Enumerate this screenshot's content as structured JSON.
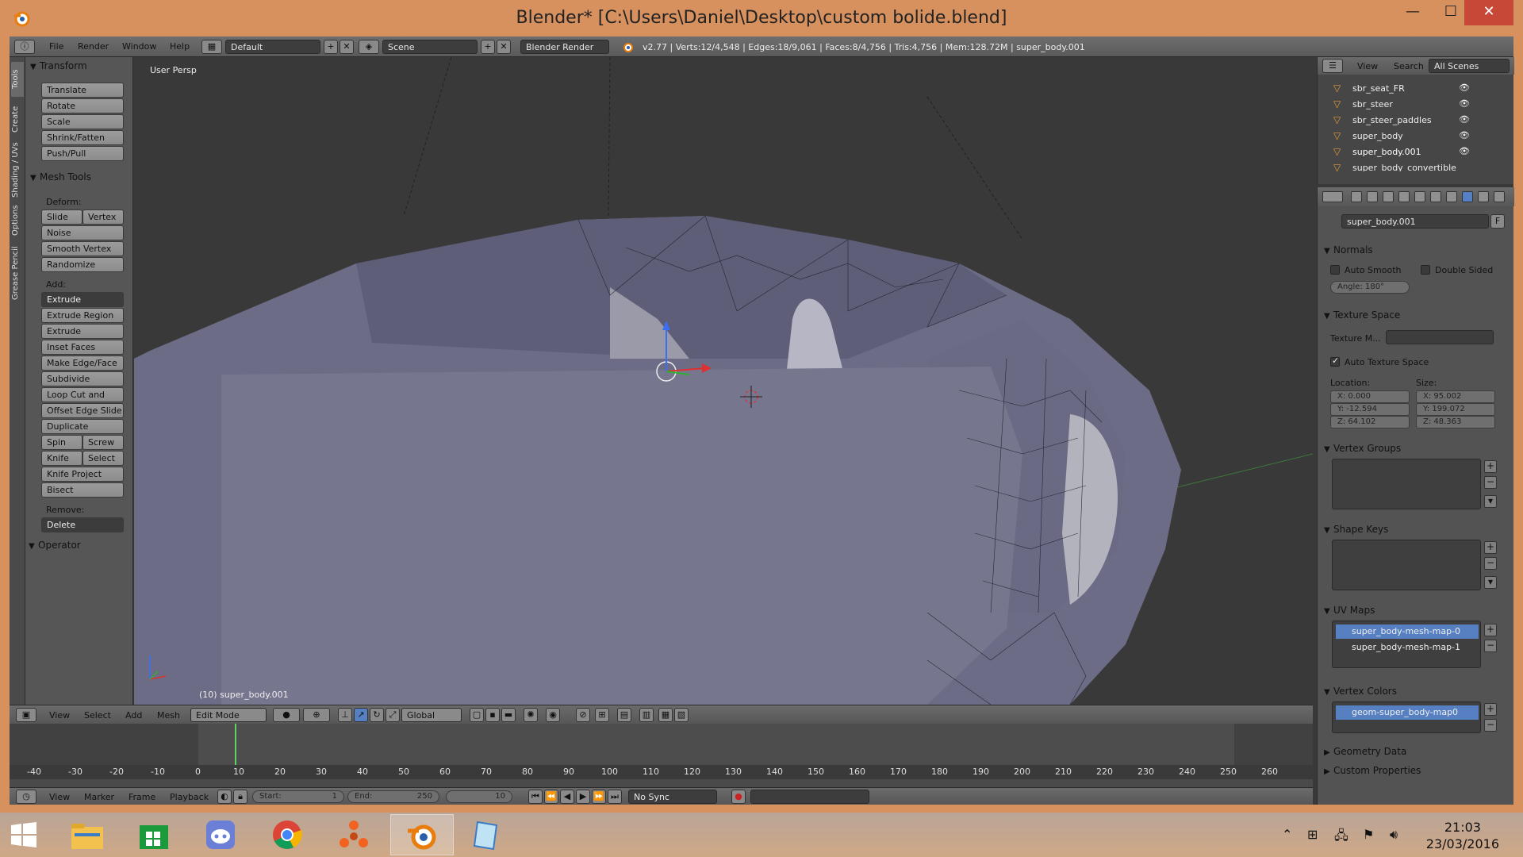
{
  "window": {
    "title": "Blender* [C:\\Users\\Daniel\\Desktop\\custom bolide.blend]",
    "min_label": "—",
    "max_label": "☐",
    "close_label": "✕"
  },
  "menubar": {
    "items": [
      "File",
      "Render",
      "Window",
      "Help"
    ],
    "layout": "Default",
    "scene": "Scene",
    "engine": "Blender Render",
    "stats": "v2.77 | Verts:12/4,548 | Edges:18/9,061 | Faces:8/4,756 | Tris:4,756 | Mem:128.72M | super_body.001"
  },
  "left_tabs": [
    "Tools",
    "Create",
    "Shading / UVs",
    "Options",
    "Grease Pencil"
  ],
  "tool_panel": {
    "transform": {
      "title": "Transform",
      "buttons": [
        "Translate",
        "Rotate",
        "Scale",
        "Shrink/Fatten",
        "Push/Pull"
      ]
    },
    "mesh_tools": {
      "title": "Mesh Tools",
      "deform_label": "Deform:",
      "slide_edge": "Slide Ed",
      "vertex": "Vertex",
      "noise": "Noise",
      "smooth_vertex": "Smooth Vertex",
      "randomize": "Randomize",
      "add_label": "Add:",
      "extrude": "Extrude",
      "add_buttons": [
        "Extrude Region",
        "Extrude Individual",
        "Inset Faces",
        "Make Edge/Face",
        "Subdivide",
        "Loop Cut and Slide",
        "Offset Edge Slide",
        "Duplicate"
      ],
      "spin": "Spin",
      "screw": "Screw",
      "knife": "Knife",
      "select": "Select",
      "knife_project": "Knife Project",
      "bisect": "Bisect",
      "remove_label": "Remove:",
      "delete": "Delete"
    },
    "operator": "Operator"
  },
  "viewport": {
    "label": "User Persp",
    "object_name": "(10) super_body.001"
  },
  "viewport_header": {
    "items": [
      "View",
      "Select",
      "Add",
      "Mesh"
    ],
    "mode": "Edit Mode",
    "orientation": "Global"
  },
  "timeline": {
    "ticks": [
      "-40",
      "-30",
      "-20",
      "-10",
      "0",
      "10",
      "20",
      "30",
      "40",
      "50",
      "60",
      "70",
      "80",
      "90",
      "100",
      "110",
      "120",
      "130",
      "140",
      "150",
      "160",
      "170",
      "180",
      "190",
      "200",
      "210",
      "220",
      "230",
      "240",
      "250",
      "260"
    ],
    "current_frame_value": 10,
    "header_items": [
      "View",
      "Marker",
      "Frame",
      "Playback"
    ],
    "start": "Start:",
    "start_value": "1",
    "end": "End:",
    "end_value": "250",
    "current": "10",
    "sync": "No Sync"
  },
  "outliner": {
    "header": [
      "View",
      "Search"
    ],
    "scenes": "All Scenes",
    "rows": [
      "sbr_seat_FR",
      "sbr_steer",
      "sbr_steer_paddles",
      "super_body",
      "super_body.001",
      "super_body_convertible"
    ]
  },
  "properties": {
    "mesh_name": "super_body.001",
    "f_label": "F",
    "normals": {
      "title": "Normals",
      "auto_smooth": "Auto Smooth",
      "double_sided": "Double Sided",
      "angle": "Angle:   180°"
    },
    "texture_space": {
      "title": "Texture Space",
      "texture_mesh": "Texture M...",
      "auto_texture_space": "Auto Texture Space",
      "location_label": "Location:",
      "size_label": "Size:",
      "loc_x": "X:          0.000",
      "loc_y": "Y:      -12.594",
      "loc_z": "Z:        64.102",
      "size_x": "X:        95.002",
      "size_y": "Y:      199.072",
      "size_z": "Z:        48.363"
    },
    "vertex_groups": "Vertex Groups",
    "shape_keys": "Shape Keys",
    "uv_maps": {
      "title": "UV Maps",
      "items": [
        "super_body-mesh-map-0",
        "super_body-mesh-map-1"
      ]
    },
    "vertex_colors": {
      "title": "Vertex Colors",
      "items": [
        "geom-super_body-map0"
      ]
    },
    "geometry_data": "Geometry Data",
    "custom_properties": "Custom Properties"
  },
  "taskbar": {
    "time": "21:03",
    "date": "23/03/2016"
  },
  "colors": {
    "titlebar": "#d7915f",
    "close": "#c74836",
    "viewport": "#393939",
    "selection": "#5680c2",
    "mesh": "#7c7c94"
  }
}
